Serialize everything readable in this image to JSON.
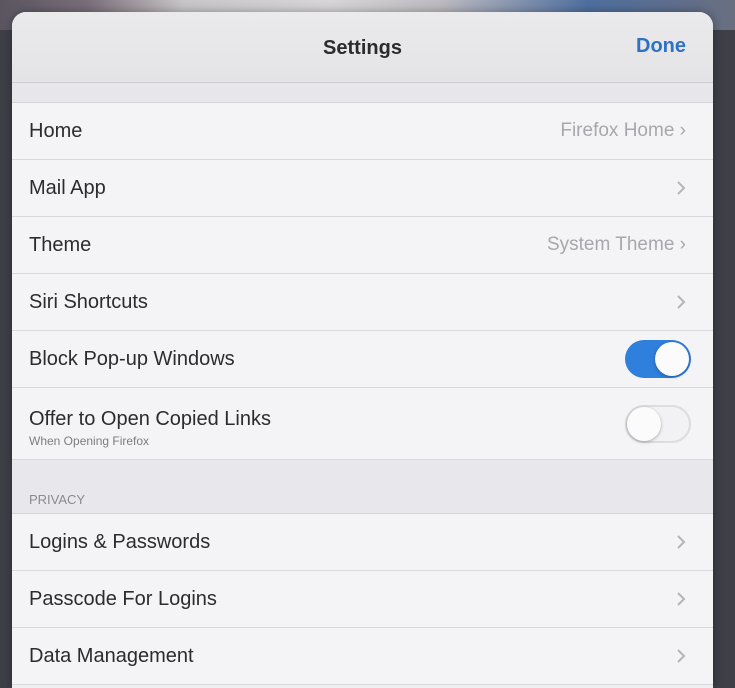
{
  "nav": {
    "title": "Settings",
    "done_label": "Done"
  },
  "rows_general": [
    {
      "label": "Home",
      "detail": "Firefox Home"
    },
    {
      "label": "Mail App",
      "detail": ""
    },
    {
      "label": "Theme",
      "detail": "System Theme"
    },
    {
      "label": "Siri Shortcuts",
      "detail": ""
    }
  ],
  "toggles": [
    {
      "label": "Block Pop-up Windows",
      "on": true
    },
    {
      "label": "Offer to Open Copied Links",
      "subtitle": "When Opening Firefox",
      "on": false
    }
  ],
  "privacy": {
    "header": "PRIVACY",
    "rows": [
      {
        "label": "Logins & Passwords"
      },
      {
        "label": "Passcode For Logins"
      },
      {
        "label": "Data Management"
      }
    ]
  },
  "colors": {
    "accent": "#2e72c4",
    "toggle_on": "#2f7fdc"
  },
  "icons": {
    "disclosure": "chevron-right-icon"
  }
}
